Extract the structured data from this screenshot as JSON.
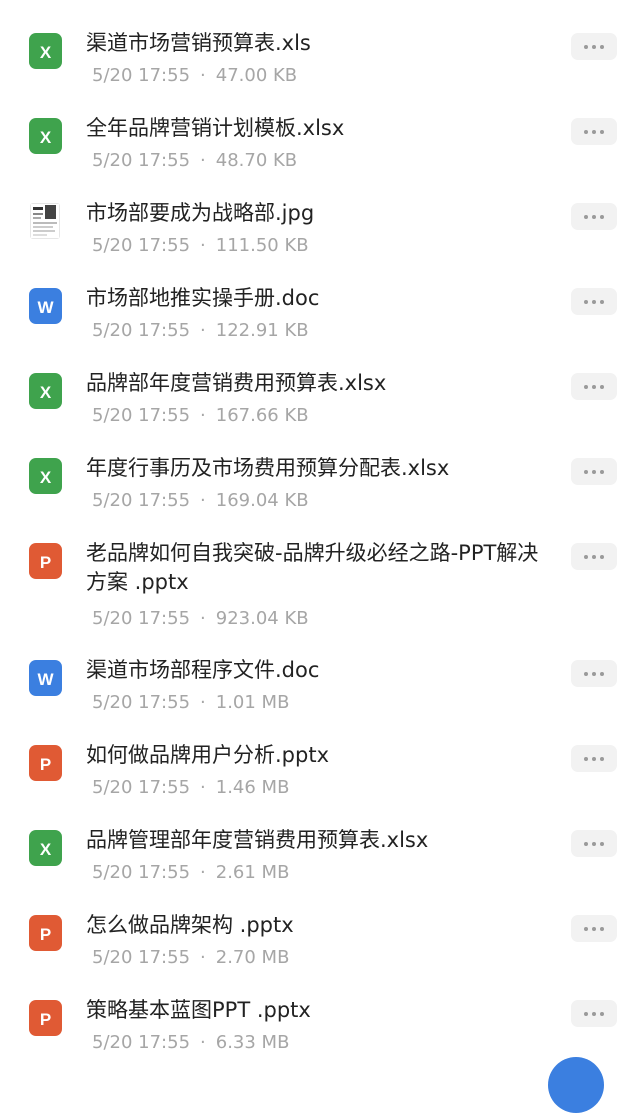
{
  "files": [
    {
      "type": "X",
      "name": "渠道市场营销预算表.xls",
      "date": "5/20 17:55",
      "separator": "·",
      "size": "47.00 KB",
      "icon": "excel-icon"
    },
    {
      "type": "X",
      "name": "全年品牌营销计划模板.xlsx",
      "date": "5/20 17:55",
      "separator": "·",
      "size": "48.70 KB",
      "icon": "excel-icon"
    },
    {
      "type": "IMG",
      "name": "市场部要成为战略部.jpg",
      "date": "5/20 17:55",
      "separator": "·",
      "size": "111.50 KB",
      "icon": "image-thumbnail-icon"
    },
    {
      "type": "W",
      "name": "市场部地推实操手册.doc",
      "date": "5/20 17:55",
      "separator": "·",
      "size": "122.91 KB",
      "icon": "word-icon"
    },
    {
      "type": "X",
      "name": "品牌部年度营销费用预算表.xlsx",
      "date": "5/20 17:55",
      "separator": "·",
      "size": "167.66 KB",
      "icon": "excel-icon"
    },
    {
      "type": "X",
      "name": "年度行事历及市场费用预算分配表.xlsx",
      "date": "5/20 17:55",
      "separator": "·",
      "size": "169.04 KB",
      "icon": "excel-icon"
    },
    {
      "type": "P",
      "name": "老品牌如何自我突破-品牌升级必经之路-PPT解决方案 .pptx",
      "date": "5/20 17:55",
      "separator": "·",
      "size": "923.04 KB",
      "icon": "powerpoint-icon"
    },
    {
      "type": "W",
      "name": "渠道市场部程序文件.doc",
      "date": "5/20 17:55",
      "separator": "·",
      "size": "1.01 MB",
      "icon": "word-icon"
    },
    {
      "type": "P",
      "name": "如何做品牌用户分析.pptx",
      "date": "5/20 17:55",
      "separator": "·",
      "size": "1.46 MB",
      "icon": "powerpoint-icon"
    },
    {
      "type": "X",
      "name": "品牌管理部年度营销费用预算表.xlsx",
      "date": "5/20 17:55",
      "separator": "·",
      "size": "2.61 MB",
      "icon": "excel-icon"
    },
    {
      "type": "P",
      "name": "怎么做品牌架构 .pptx",
      "date": "5/20 17:55",
      "separator": "·",
      "size": "2.70 MB",
      "icon": "powerpoint-icon"
    },
    {
      "type": "P",
      "name": "策略基本蓝图PPT .pptx",
      "date": "5/20 17:55",
      "separator": "·",
      "size": "6.33 MB",
      "icon": "powerpoint-icon"
    }
  ],
  "more_icon": "more-dots-icon",
  "colors": {
    "excel": "#3fa34d",
    "word": "#3b7fe0",
    "powerpoint": "#e05a34",
    "meta_text": "#a6a6a6",
    "name_text": "#222222"
  }
}
